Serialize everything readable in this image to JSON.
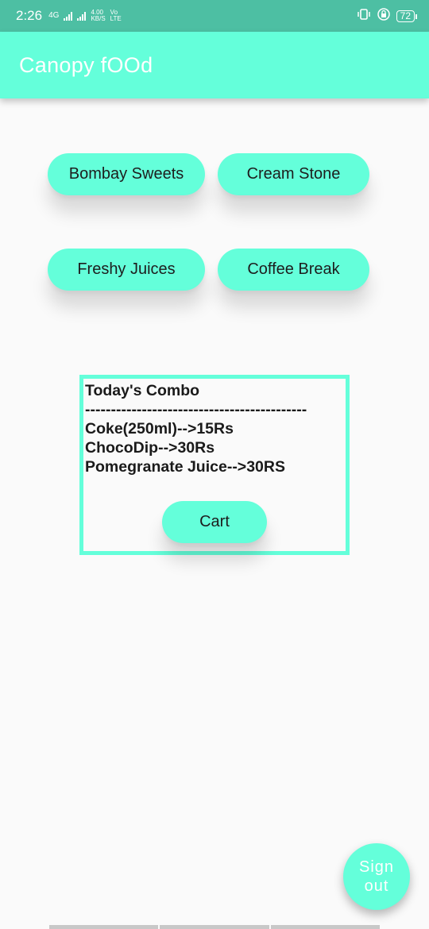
{
  "status_bar": {
    "time": "2:26",
    "network_label": "4G",
    "speed_value": "4.00",
    "speed_unit": "KB/S",
    "volte_top": "Vo",
    "volte_bottom": "LTE",
    "battery": "72"
  },
  "app_bar": {
    "title": "Canopy fOOd"
  },
  "restaurants": {
    "bombay": "Bombay Sweets",
    "cream": "Cream Stone",
    "freshy": "Freshy Juices",
    "coffee": "Coffee Break"
  },
  "combo": {
    "heading": "Today's Combo",
    "divider": "-------------------------------------------",
    "items": [
      "Coke(250ml)-->15Rs",
      "ChocoDip-->30Rs",
      "Pomegranate Juice-->30RS"
    ],
    "cart_label": "Cart"
  },
  "fab": {
    "line1": "Sign",
    "line2": "out"
  },
  "colors": {
    "accent": "#64ffda",
    "status_bar": "#4dbfa3",
    "background": "#fafafa"
  }
}
